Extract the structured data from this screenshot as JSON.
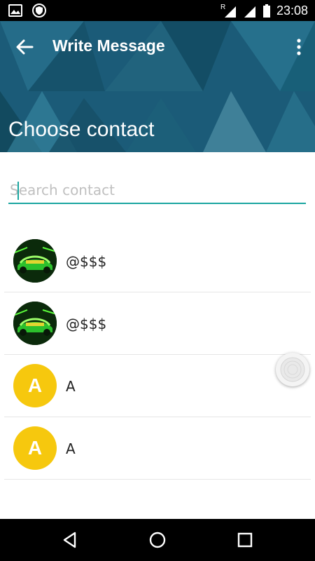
{
  "status_bar": {
    "time": "23:08",
    "left_icons": [
      "image-icon",
      "vpn-shield-icon"
    ],
    "right_icons": [
      "roaming-signal-icon",
      "signal-icon",
      "battery-icon"
    ],
    "roaming_label": "R"
  },
  "toolbar": {
    "title": "Write Message",
    "back_icon": "arrow-back-icon",
    "menu_icon": "overflow-menu-icon"
  },
  "header": {
    "page_title": "Choose contact",
    "bg_color": "#1b5b78"
  },
  "search": {
    "placeholder": "Search contact",
    "value": "",
    "accent_color": "#1aa5a0"
  },
  "contacts": [
    {
      "name": "@$$$",
      "avatar": "photo"
    },
    {
      "name": "@$$$",
      "avatar": "photo"
    },
    {
      "name": "A",
      "avatar": "A"
    },
    {
      "name": "A",
      "avatar": "A"
    }
  ],
  "avatar_color": "#f6c80e",
  "nav_bar": {
    "buttons": [
      "back-triangle-icon",
      "home-circle-icon",
      "recents-square-icon"
    ]
  }
}
